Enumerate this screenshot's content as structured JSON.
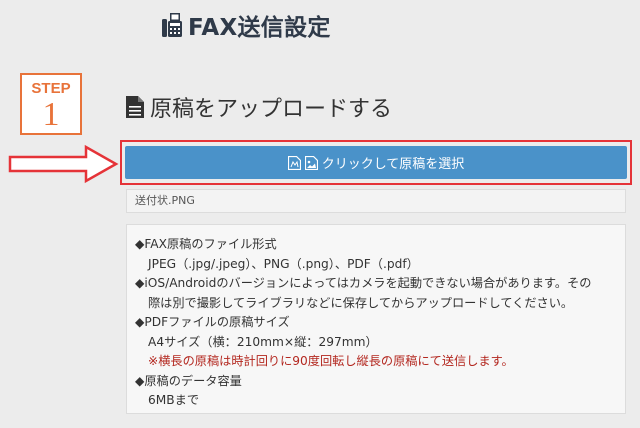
{
  "header": {
    "title": "FAX送信設定",
    "icon": "fax-icon"
  },
  "step": {
    "label": "STEP",
    "number": "1",
    "color": "#e8733a"
  },
  "section": {
    "title": "原稿をアップロードする",
    "icon": "document-icon"
  },
  "upload": {
    "button_label": "クリックして原稿を選択",
    "button_color": "#4a92c9",
    "highlight_color": "#e53338",
    "icons": [
      "pdf-file-icon",
      "image-file-icon"
    ]
  },
  "file": {
    "name": "送付状.PNG"
  },
  "info": {
    "format_heading": "◆FAX原稿のファイル形式",
    "format_value": "JPEG（.jpg/.jpeg）、PNG（.png）、PDF（.pdf）",
    "ios_note_line1": "◆iOS/Androidのバージョンによってはカメラを起動できない場合があります。その",
    "ios_note_line2": "際は別で撮影してライブラリなどに保存してからアップロードしてください。",
    "pdf_heading": "◆PDFファイルの原稿サイズ",
    "pdf_size": "A4サイズ（横：210mm×縦：297mm）",
    "pdf_warning": "※横長の原稿は時計回りに90度回転し縦長の原稿にて送信します。",
    "capacity_heading": "◆原稿のデータ容量",
    "capacity_value": "6MBまで"
  }
}
